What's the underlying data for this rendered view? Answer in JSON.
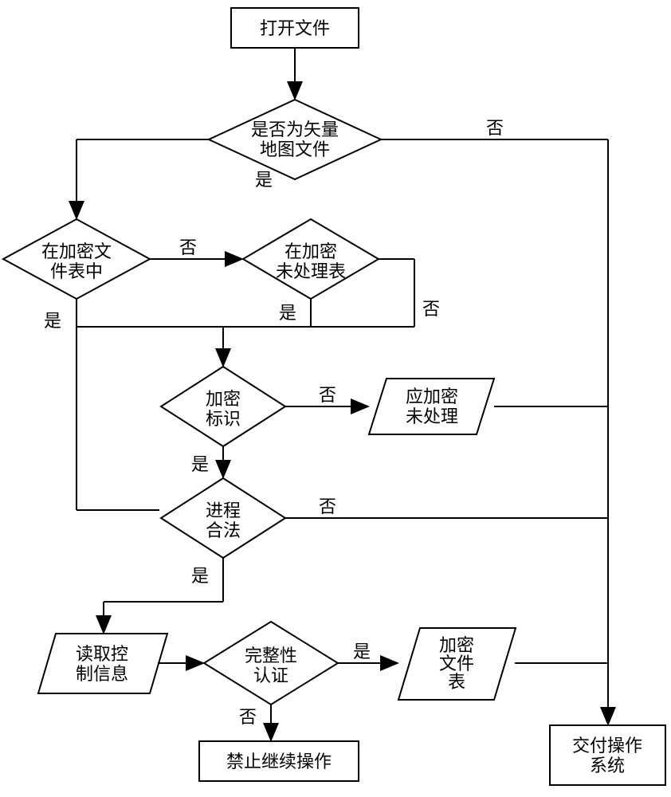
{
  "chart_data": {
    "type": "flowchart",
    "nodes": {
      "openFile": "打开文件",
      "isVectorMap": "是否为矢量\n地图文件",
      "inEncryptedTable": "在加密文\n件表中",
      "inUnprocessedTable": "在加密\n未处理表",
      "encryptFlag": "加密\n标识",
      "shouldEncryptUnprocessed": "应加密\n未处理",
      "processLegal": "进程\n合法",
      "readControlInfo": "读取控\n制信息",
      "integrityAuth": "完整性\n认证",
      "encryptedFileTable": "加密\n文件\n表",
      "forbidContinue": "禁止继续操作",
      "deliverOS": "交付操作\n系统"
    },
    "labels": {
      "yes": "是",
      "no": "否"
    }
  }
}
